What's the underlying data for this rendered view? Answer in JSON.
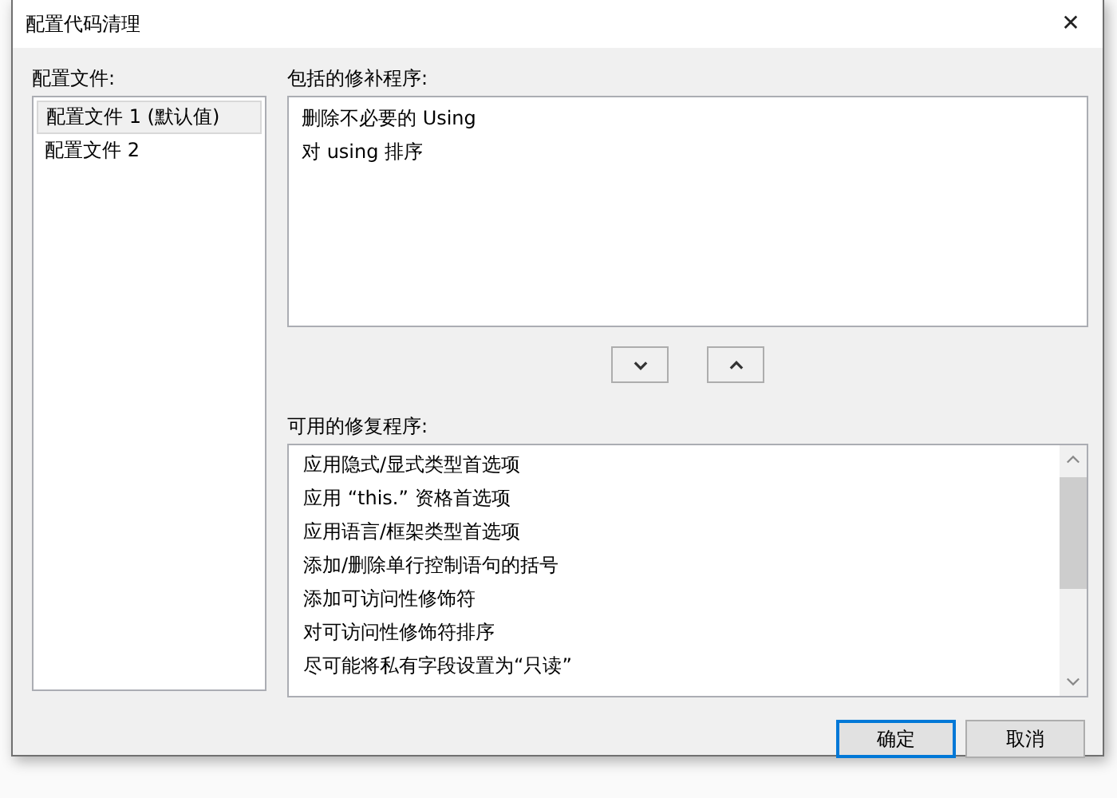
{
  "window": {
    "title": "配置代码清理",
    "close": "✕"
  },
  "profiles": {
    "label": "配置文件:",
    "items": [
      {
        "text": "配置文件 1 (默认值)",
        "selected": true
      },
      {
        "text": "配置文件 2",
        "selected": false
      }
    ]
  },
  "included": {
    "label": "包括的修补程序:",
    "items": [
      "删除不必要的 Using",
      "对 using 排序"
    ]
  },
  "move_buttons": [
    {
      "kind": "down"
    },
    {
      "kind": "up"
    }
  ],
  "available": {
    "label": "可用的修复程序:",
    "items": [
      "应用隐式/显式类型首选项",
      "应用 “this.” 资格首选项",
      "应用语言/框架类型首选项",
      "添加/删除单行控制语句的括号",
      "添加可访问性修饰符",
      "对可访问性修饰符排序",
      "尽可能将私有字段设置为“只读”"
    ]
  },
  "buttons": [
    {
      "label": "确定",
      "default": true
    },
    {
      "label": "取消",
      "default": false
    }
  ]
}
